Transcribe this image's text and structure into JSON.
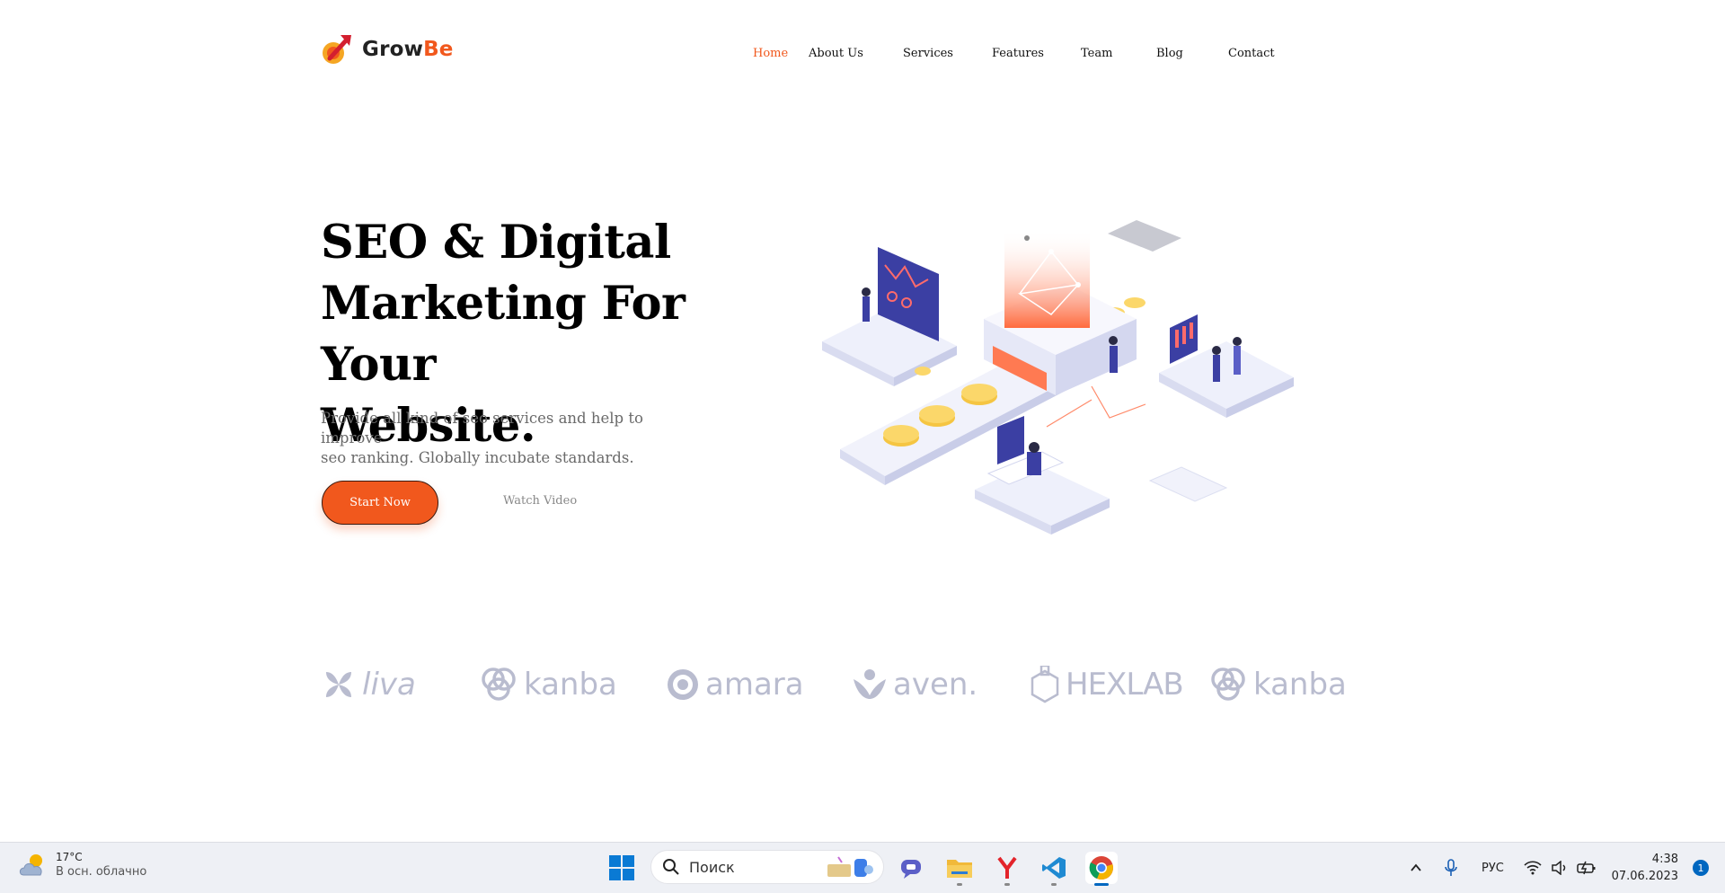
{
  "header": {
    "logo_text_part1": "Grow",
    "logo_text_part2": "Be",
    "nav": [
      {
        "label": "Home",
        "active": true
      },
      {
        "label": "About Us",
        "active": false
      },
      {
        "label": "Services",
        "active": false
      },
      {
        "label": "Features",
        "active": false
      },
      {
        "label": "Team",
        "active": false
      },
      {
        "label": "Blog",
        "active": false
      },
      {
        "label": "Contact",
        "active": false
      }
    ]
  },
  "hero": {
    "title_line1": "SEO & Digital",
    "title_line2": "Marketing For Your",
    "title_line3": "Website.",
    "description_line1": "Provide all kind of seo services and help to improve",
    "description_line2": "seo ranking. Globally incubate standards.",
    "primary_button": "Start Now",
    "secondary_button": "Watch Video"
  },
  "brands": [
    "liva",
    "kanba",
    "amara",
    "aven.",
    "HEXLAB",
    "kanba"
  ],
  "taskbar": {
    "weather_temp": "17°C",
    "weather_desc": "В осн. облачно",
    "search_placeholder": "Поиск",
    "language": "РУС",
    "time": "4:38",
    "date": "07.06.2023",
    "notification_count": "1"
  },
  "colors": {
    "accent": "#f1581d",
    "brand_logo": "#b9bccf",
    "taskbar_bg": "#eef0f5"
  }
}
